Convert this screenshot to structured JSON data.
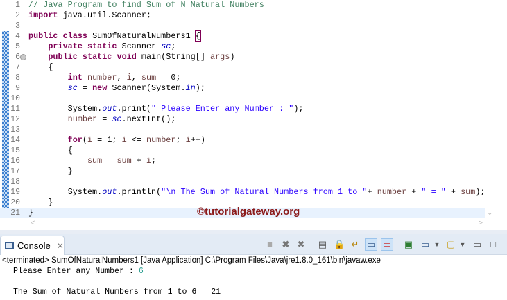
{
  "editor": {
    "lines": [
      [
        [
          "c",
          "// Java Program to find Sum of N Natural Numbers"
        ]
      ],
      [
        [
          "k",
          "import"
        ],
        [
          "p",
          " java.util.Scanner;"
        ]
      ],
      [],
      [
        [
          "k",
          "public"
        ],
        [
          "p",
          " "
        ],
        [
          "k",
          "class"
        ],
        [
          "p",
          " SumOfNaturalNumbers1 "
        ],
        [
          "b",
          "{"
        ]
      ],
      [
        [
          "p",
          "    "
        ],
        [
          "k",
          "private"
        ],
        [
          "p",
          " "
        ],
        [
          "k",
          "static"
        ],
        [
          "p",
          " Scanner "
        ],
        [
          "f",
          "sc"
        ],
        [
          "p",
          ";"
        ]
      ],
      [
        [
          "p",
          "    "
        ],
        [
          "k",
          "public"
        ],
        [
          "p",
          " "
        ],
        [
          "k",
          "static"
        ],
        [
          "p",
          " "
        ],
        [
          "k",
          "void"
        ],
        [
          "p",
          " main(String[] "
        ],
        [
          "v",
          "args"
        ],
        [
          "p",
          ")"
        ]
      ],
      [
        [
          "p",
          "    {"
        ]
      ],
      [
        [
          "p",
          "        "
        ],
        [
          "k",
          "int"
        ],
        [
          "p",
          " "
        ],
        [
          "v",
          "number"
        ],
        [
          "p",
          ", "
        ],
        [
          "v",
          "i"
        ],
        [
          "p",
          ", "
        ],
        [
          "v",
          "sum"
        ],
        [
          "p",
          " = 0;"
        ]
      ],
      [
        [
          "p",
          "        "
        ],
        [
          "f",
          "sc"
        ],
        [
          "p",
          " = "
        ],
        [
          "k",
          "new"
        ],
        [
          "p",
          " Scanner(System."
        ],
        [
          "f",
          "in"
        ],
        [
          "p",
          ");"
        ]
      ],
      [],
      [
        [
          "p",
          "        System."
        ],
        [
          "f",
          "out"
        ],
        [
          "p",
          ".print("
        ],
        [
          "s",
          "\" Please Enter any Number : \""
        ],
        [
          "p",
          ");"
        ]
      ],
      [
        [
          "p",
          "        "
        ],
        [
          "v",
          "number"
        ],
        [
          "p",
          " = "
        ],
        [
          "f",
          "sc"
        ],
        [
          "p",
          ".nextInt();"
        ]
      ],
      [],
      [
        [
          "p",
          "        "
        ],
        [
          "k",
          "for"
        ],
        [
          "p",
          "("
        ],
        [
          "v",
          "i"
        ],
        [
          "p",
          " = 1; "
        ],
        [
          "v",
          "i"
        ],
        [
          "p",
          " <= "
        ],
        [
          "v",
          "number"
        ],
        [
          "p",
          "; "
        ],
        [
          "v",
          "i"
        ],
        [
          "p",
          "++)"
        ]
      ],
      [
        [
          "p",
          "        {"
        ]
      ],
      [
        [
          "p",
          "            "
        ],
        [
          "v",
          "sum"
        ],
        [
          "p",
          " = "
        ],
        [
          "v",
          "sum"
        ],
        [
          "p",
          " + "
        ],
        [
          "v",
          "i"
        ],
        [
          "p",
          ";"
        ]
      ],
      [
        [
          "p",
          "        }"
        ]
      ],
      [],
      [
        [
          "p",
          "        System."
        ],
        [
          "f",
          "out"
        ],
        [
          "p",
          ".println("
        ],
        [
          "s",
          "\"\\n The Sum of Natural Numbers from 1 to \""
        ],
        [
          "p",
          "+ "
        ],
        [
          "v",
          "number"
        ],
        [
          "p",
          " + "
        ],
        [
          "s",
          "\" = \""
        ],
        [
          "p",
          " + "
        ],
        [
          "v",
          "sum"
        ],
        [
          "p",
          ");"
        ]
      ],
      [
        [
          "p",
          "    }"
        ]
      ],
      [
        [
          "p",
          "}"
        ]
      ]
    ],
    "watermark": "©tutorialgateway.org"
  },
  "console": {
    "tab_label": "Console",
    "status": "<terminated> SumOfNaturalNumbers1 [Java Application] C:\\Program Files\\Java\\jre1.8.0_161\\bin\\javaw.exe",
    "output_prompt": " Please Enter any Number : ",
    "output_input": "6",
    "output_result": " The Sum of Natural Numbers from 1 to 6 = 21"
  }
}
